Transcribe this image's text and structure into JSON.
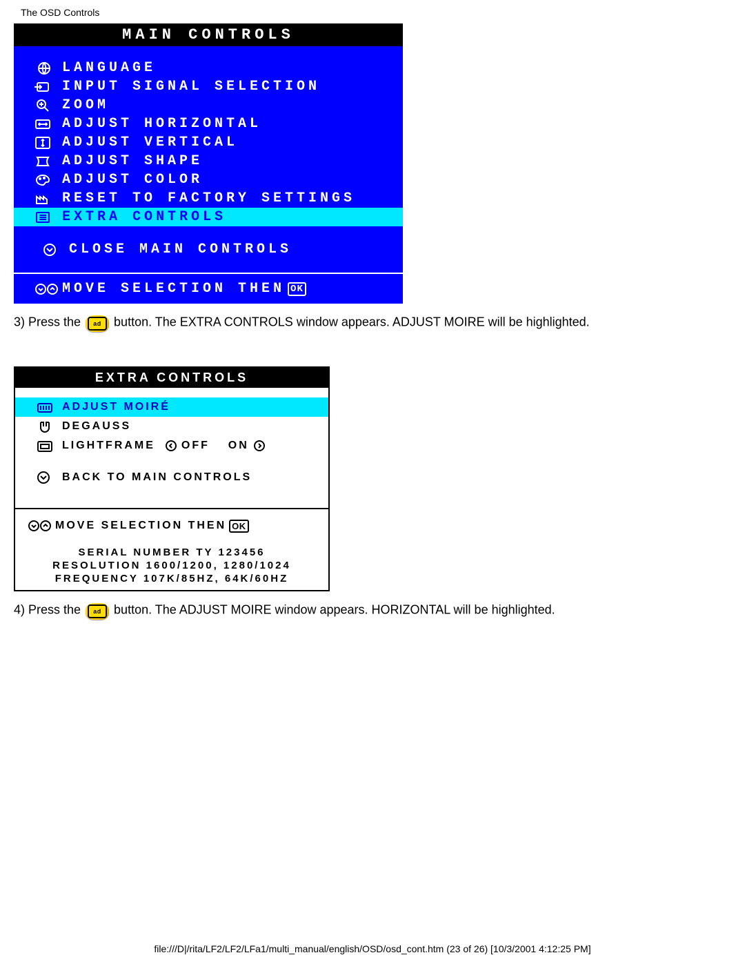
{
  "page_header": "The OSD Controls",
  "main": {
    "title": "MAIN CONTROLS",
    "items": [
      {
        "label": "LANGUAGE"
      },
      {
        "label": "INPUT SIGNAL SELECTION"
      },
      {
        "label": "ZOOM"
      },
      {
        "label": "ADJUST HORIZONTAL"
      },
      {
        "label": "ADJUST VERTICAL"
      },
      {
        "label": "ADJUST SHAPE"
      },
      {
        "label": "ADJUST COLOR"
      },
      {
        "label": "RESET TO FACTORY SETTINGS"
      },
      {
        "label": "EXTRA CONTROLS"
      }
    ],
    "close": "CLOSE MAIN CONTROLS",
    "footer": "MOVE SELECTION THEN",
    "footer_ok": "OK"
  },
  "step3": {
    "prefix": "3) Press the ",
    "ok": "ad",
    "suffix": " button. The EXTRA CONTROLS window appears. ADJUST MOIRE will be highlighted."
  },
  "extra": {
    "title": "EXTRA CONTROLS",
    "items": [
      {
        "label": "ADJUST MOIRÉ"
      },
      {
        "label": "DEGAUSS"
      },
      {
        "label": "LIGHTFRAME",
        "off": "OFF",
        "on": "ON"
      }
    ],
    "back": "BACK TO MAIN CONTROLS",
    "footer": "MOVE SELECTION THEN",
    "footer_ok": "OK",
    "serial": "SERIAL NUMBER TY 123456",
    "resolution": "RESOLUTION 1600/1200, 1280/1024",
    "frequency": "FREQUENCY 107K/85HZ, 64K/60HZ"
  },
  "step4": {
    "prefix": "4) Press the ",
    "ok": "ad",
    "suffix": " button. The ADJUST MOIRE window appears. HORIZONTAL will be highlighted."
  },
  "footer_path": "file:///D|/rita/LF2/LF2/LFa1/multi_manual/english/OSD/osd_cont.htm (23 of 26) [10/3/2001 4:12:25 PM]"
}
